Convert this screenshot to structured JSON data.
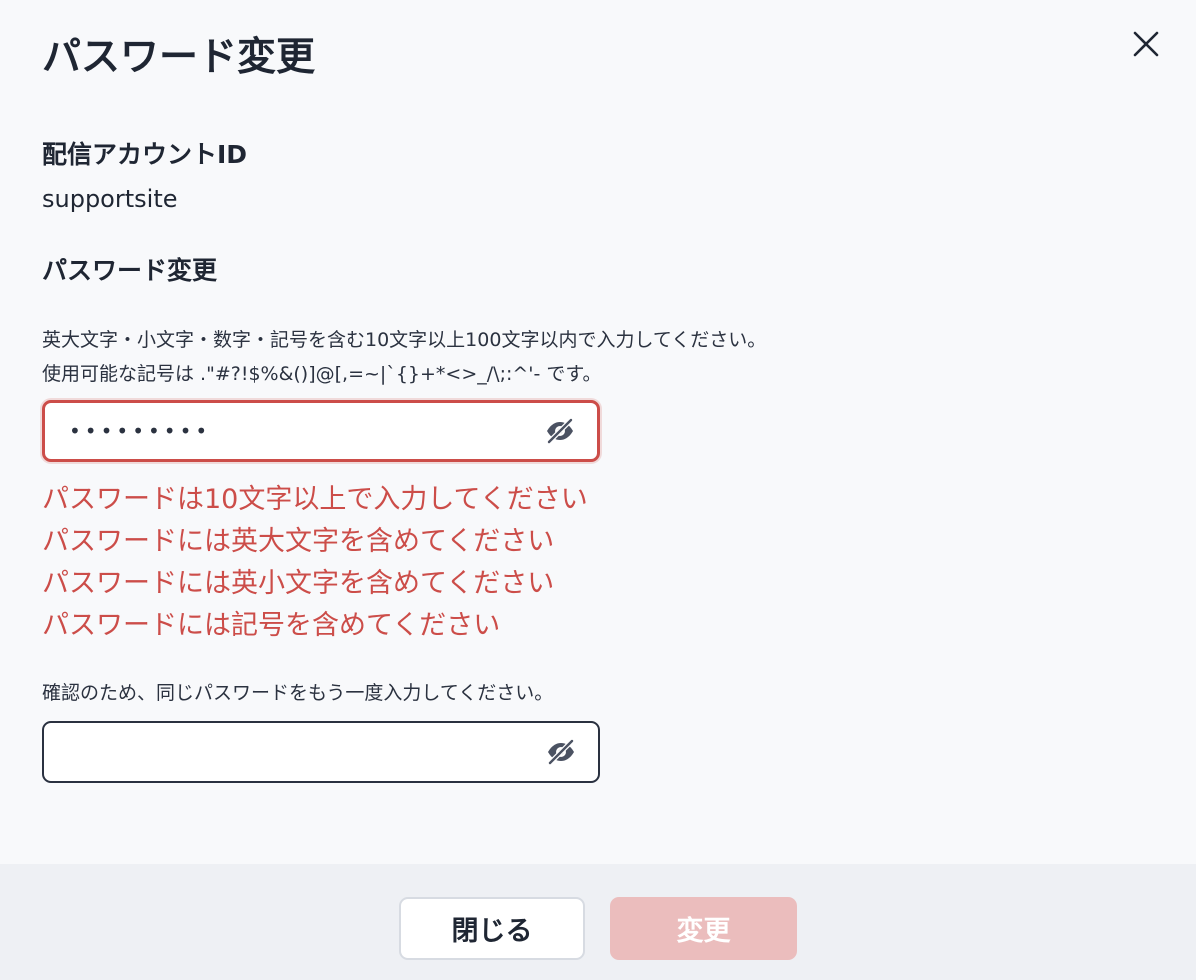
{
  "title": "パスワード変更",
  "close_icon": "close-icon",
  "account": {
    "label": "配信アカウントID",
    "value": "supportsite"
  },
  "password": {
    "label": "パスワード変更",
    "help_line1": "英大文字・小文字・数字・記号を含む10文字以上100文字以内で入力してください。",
    "help_line2": "使用可能な記号は .\"#?!$%&()]@[,=~|`{}+*<>_/\\;:^'- です。",
    "value": "•••••••••",
    "toggle_icon": "eye-off-icon",
    "errors": [
      "パスワードは10文字以上で入力してください",
      "パスワードには英大文字を含めてください",
      "パスワードには英小文字を含めてください",
      "パスワードには記号を含めてください"
    ]
  },
  "confirm": {
    "help": "確認のため、同じパスワードをもう一度入力してください。",
    "value": "",
    "toggle_icon": "eye-off-icon"
  },
  "footer": {
    "close_label": "閉じる",
    "submit_label": "変更"
  },
  "colors": {
    "error": "#cc4d49",
    "submit_disabled": "#ebbdbd",
    "text": "#1f2633",
    "background": "#f8f9fb",
    "footer_background": "#eef0f4"
  }
}
